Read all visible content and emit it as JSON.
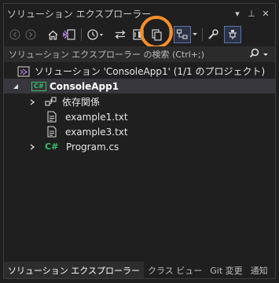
{
  "window": {
    "title": "ソリューション エクスプローラー",
    "controls": [
      "▾",
      "⊥",
      "✕"
    ]
  },
  "toolbar": {
    "buttons": [
      {
        "name": "back-icon"
      },
      {
        "name": "forward-icon"
      },
      {
        "name": "home-icon"
      },
      {
        "name": "switch-views-icon"
      },
      {
        "name": "pending-changes-filter-icon"
      },
      {
        "name": "sync-active-document-icon"
      },
      {
        "name": "collapse-all-icon"
      },
      {
        "name": "show-all-files-icon"
      },
      {
        "name": "preview-selected-items-icon"
      },
      {
        "name": "properties-icon"
      },
      {
        "name": "pin-preview-icon"
      }
    ]
  },
  "search": {
    "placeholder": "ソリューション エクスプローラー の検索 (Ctrl+;)"
  },
  "tree": {
    "solution": "ソリューション 'ConsoleApp1' (1/1 のプロジェクト)",
    "project": "ConsoleApp1",
    "project_badge": "C#",
    "items": [
      {
        "label": "依存関係",
        "type": "dependencies"
      },
      {
        "label": "example1.txt",
        "type": "file"
      },
      {
        "label": "example3.txt",
        "type": "file"
      },
      {
        "label": "Program.cs",
        "type": "csharp",
        "badge": "C#"
      }
    ]
  },
  "tabs": [
    "ソリューション エクスプローラー",
    "クラス ビュー",
    "Git 変更",
    "通知"
  ],
  "colors": {
    "background": "#1f1f1f",
    "selection": "#37373d",
    "highlight_ring": "#f7902a",
    "csharp_green": "#3bbf6b",
    "vs_purple": "#a074c4"
  }
}
